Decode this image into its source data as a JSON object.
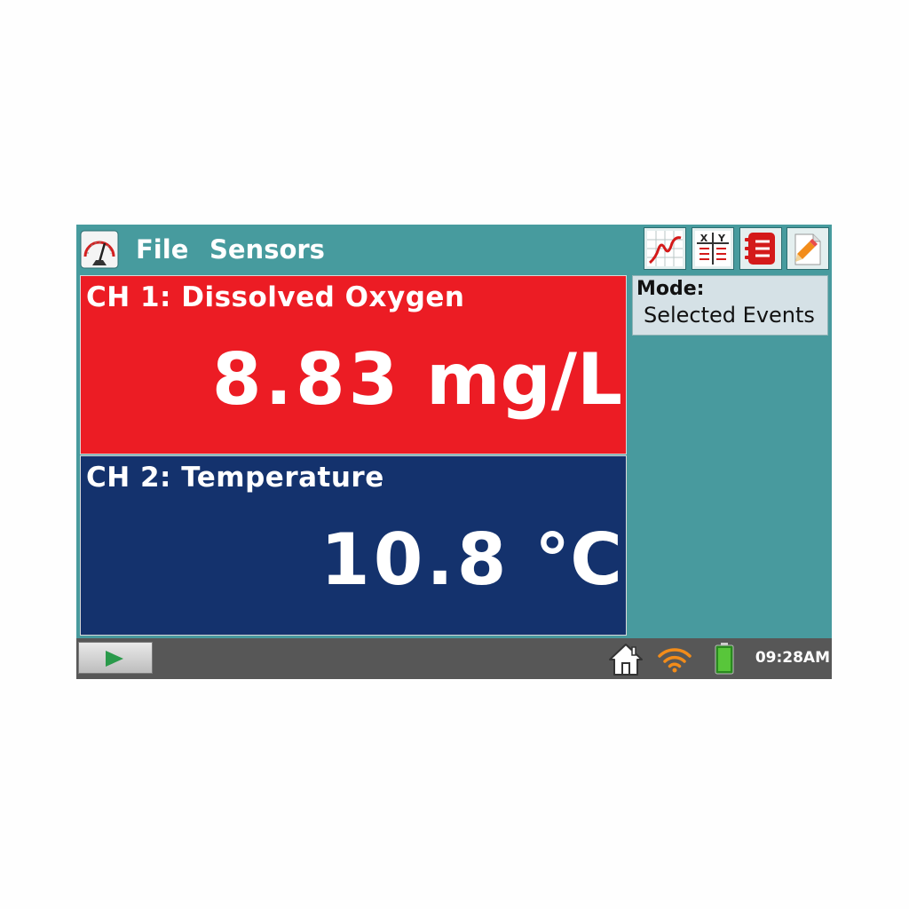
{
  "menu": {
    "file": "File",
    "sensors": "Sensors"
  },
  "toolbar": {
    "graph_icon": "graph-icon",
    "table_icon": "table-icon",
    "events_icon": "event-list-icon",
    "notes_icon": "notes-pencil-icon"
  },
  "channels": [
    {
      "label": "CH 1: Dissolved Oxygen",
      "value": "8.83",
      "unit": "mg/L",
      "color": "#ec1c24"
    },
    {
      "label": "CH 2: Temperature",
      "value": "10.8",
      "unit": "°C",
      "color": "#14326d"
    }
  ],
  "mode": {
    "title": "Mode:",
    "value": "Selected Events"
  },
  "status": {
    "time": "09:28AM",
    "accent": "#479b9e"
  }
}
